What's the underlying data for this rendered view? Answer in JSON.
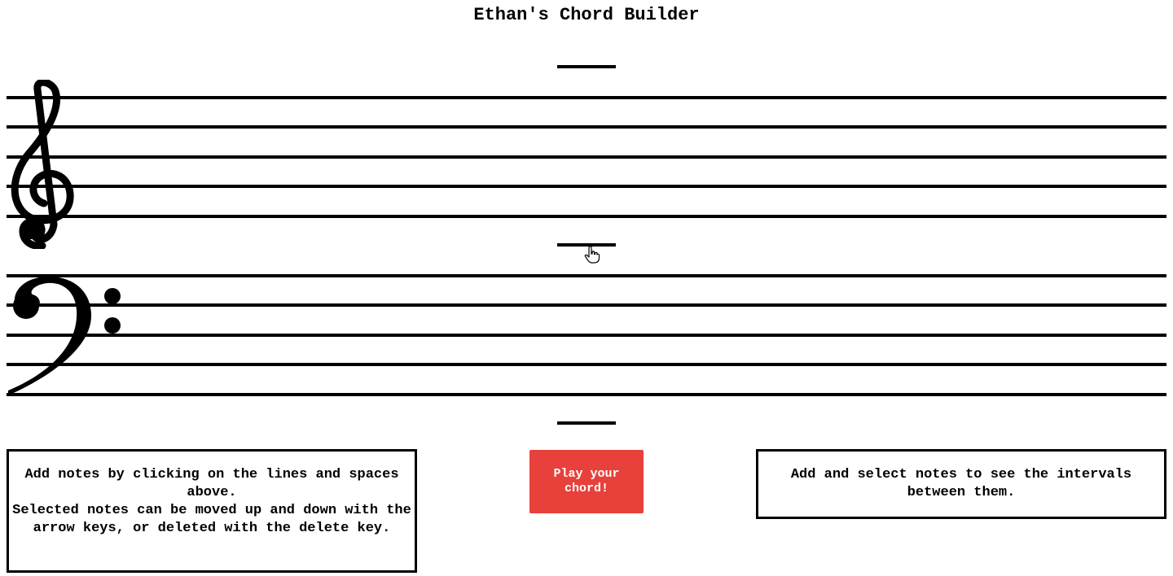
{
  "header": {
    "title": "Ethan's Chord Builder"
  },
  "staff": {
    "treble_clef_icon": "treble-clef",
    "bass_clef_icon": "bass-clef"
  },
  "instructions": {
    "line1": "Add notes by clicking on the lines and spaces above.",
    "line2": "Selected notes can be moved up and down with the arrow keys, or deleted with the delete key."
  },
  "play_button": {
    "label": "Play your chord!",
    "color": "#e8403a"
  },
  "intervals": {
    "text": "Add and select notes to see the intervals between them."
  }
}
